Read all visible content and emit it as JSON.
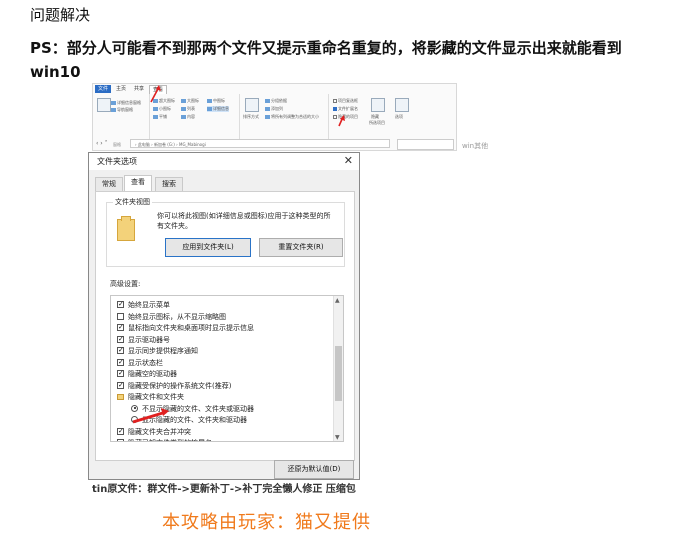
{
  "header": {
    "title": "问题解决",
    "ps": "PS：部分人可能看不到那两个文件又提示重命名重复的，将影藏的文件显示出来就能看到",
    "os": "win10"
  },
  "ribbon": {
    "tabs": [
      "文件",
      "主页",
      "共享",
      "查看"
    ],
    "active_tab": "查看",
    "items": {
      "nav_pane": "导航窗格",
      "details_pane": "详细信息窗格",
      "xl_icons": "超大图标",
      "l_icons": "大图标",
      "m_icons": "中图标",
      "s_icons": "小图标",
      "list": "列表",
      "details": "详细信息",
      "tiles": "平铺",
      "content": "内容",
      "sort": "排序方式",
      "group_by": "分组依据",
      "add_cols": "添加列",
      "size_cols": "将所有列调整为合适的大小",
      "item_checkbox": "项目复选框",
      "file_ext": "文件扩展名",
      "hidden_items": "隐藏的项目",
      "hide_sel": "隐藏",
      "hide_sel2": "所选项目",
      "options": "选项"
    },
    "groups": {
      "panes": "窗格",
      "layout": "布局",
      "current_view": "当前视图",
      "show_hide": "显示/隐藏"
    },
    "address": "› 此电脑 › 新加卷 (G:) › MG_Mabinogi"
  },
  "watermark_top": "win其他",
  "dialog": {
    "title": "文件夹选项",
    "close": "✕",
    "tabs": [
      "常规",
      "查看",
      "搜索"
    ],
    "active_tab": "查看",
    "folder_views_label": "文件夹视图",
    "folder_views_desc": "你可以将此视图(如详细信息或图标)应用于这种类型的所有文件夹。",
    "apply_btn": "应用到文件夹(L)",
    "reset_btn": "重置文件夹(R)",
    "advanced_label": "高级设置:",
    "settings": [
      {
        "kind": "check",
        "checked": true,
        "label": "始终显示菜单"
      },
      {
        "kind": "check",
        "checked": false,
        "label": "始终显示图标，从不显示缩略图"
      },
      {
        "kind": "check",
        "checked": true,
        "label": "鼠标指向文件夹和桌面项时显示提示信息"
      },
      {
        "kind": "check",
        "checked": true,
        "label": "显示驱动器号"
      },
      {
        "kind": "check",
        "checked": true,
        "label": "显示同步提供程序通知"
      },
      {
        "kind": "check",
        "checked": true,
        "label": "显示状态栏"
      },
      {
        "kind": "check",
        "checked": true,
        "label": "隐藏空的驱动器"
      },
      {
        "kind": "check",
        "checked": true,
        "label": "隐藏受保护的操作系统文件(推荐)"
      },
      {
        "kind": "folder",
        "label": "隐藏文件和文件夹"
      },
      {
        "kind": "radio",
        "checked": true,
        "label": "不显示隐藏的文件、文件夹或驱动器"
      },
      {
        "kind": "radio",
        "checked": false,
        "label": "显示隐藏的文件、文件夹和驱动器"
      },
      {
        "kind": "check",
        "checked": true,
        "label": "隐藏文件夹合并冲突"
      },
      {
        "kind": "check",
        "checked": false,
        "label": "隐藏已知文件类型的扩展名"
      }
    ],
    "restore_btn": "还原为默认值(D)"
  },
  "watermark_bottom": "tin原文件：群文件->更新补丁->补丁完全懒人修正 压缩包",
  "credit": "本攻略由玩家：猫又提供",
  "colors": {
    "arrow": "#e02020",
    "credit": "#f07a1c",
    "accent": "#2a73c7"
  }
}
